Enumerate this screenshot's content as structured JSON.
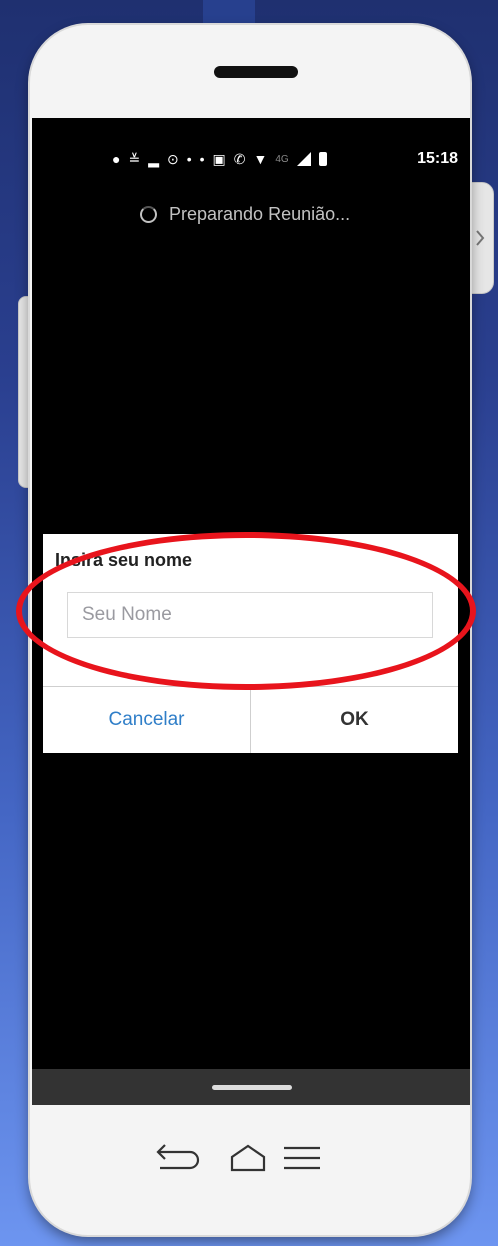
{
  "status_bar": {
    "icons": [
      "facebook-icon",
      "app-icon",
      "boat-icon",
      "record-icon",
      "dot",
      "dot",
      "cast-icon",
      "call-icon",
      "wifi-icon",
      "network-4g",
      "signal-icon",
      "battery-icon"
    ],
    "time": "15:18"
  },
  "loading": {
    "text": "Preparando Reunião..."
  },
  "dialog": {
    "title": "Insira seu nome",
    "name_input": {
      "value": "",
      "placeholder": "Seu Nome"
    },
    "cancel_label": "Cancelar",
    "ok_label": "OK"
  },
  "annotation": {
    "shape": "ellipse",
    "color": "#e8141c"
  },
  "colors": {
    "accent": "#2f7ec8",
    "screen_bg": "#000000",
    "annotation": "#e8141c"
  }
}
